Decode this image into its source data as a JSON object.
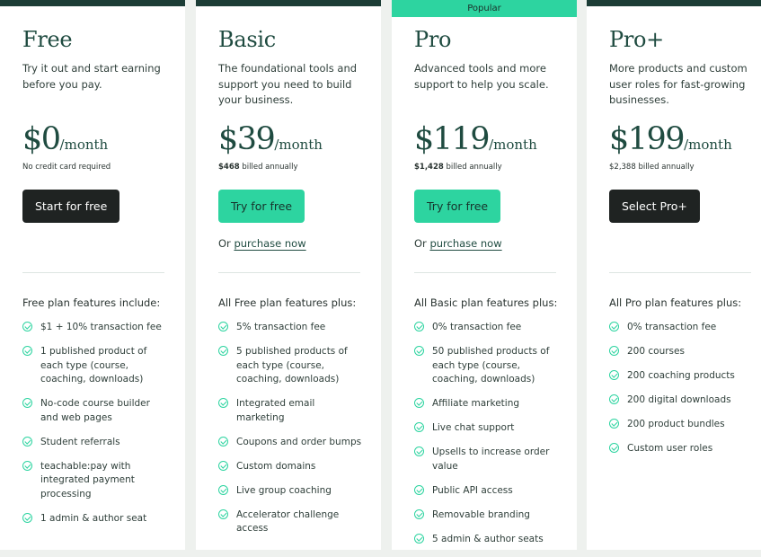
{
  "colors": {
    "dark_green": "#1c3d36",
    "accent_green": "#2dd4a0",
    "dark_button": "#1f2322",
    "background": "#eef1ee"
  },
  "plans": [
    {
      "name": "Free",
      "description": "Try it out and start earning before you pay.",
      "price_amount": "$0",
      "price_period": "/month",
      "billing_bold": "",
      "billing_text": "No credit card required",
      "cta_label": "Start for free",
      "or_prefix": "",
      "or_link": "",
      "features_heading": "Free plan features include:",
      "features": [
        "$1 + 10% transaction fee",
        "1 published product of each type (course, coaching, downloads)",
        "No-code course builder and web pages",
        "Student referrals",
        "teachable:pay with integrated payment processing",
        "1 admin & author seat"
      ]
    },
    {
      "name": "Basic",
      "description": "The foundational tools and support you need to build your business.",
      "price_amount": "$39",
      "price_period": "/month",
      "billing_bold": "$468",
      "billing_text": " billed annually",
      "cta_label": "Try for free",
      "or_prefix": "Or ",
      "or_link": "purchase now",
      "features_heading": "All Free plan features plus:",
      "features": [
        "5% transaction fee",
        "5 published products of each type (course, coaching, downloads)",
        "Integrated email marketing",
        "Coupons and order bumps",
        "Custom domains",
        "Live group coaching",
        "Accelerator challenge access"
      ]
    },
    {
      "badge": "Popular",
      "name": "Pro",
      "description": "Advanced tools and more support to help you scale.",
      "price_amount": "$119",
      "price_period": "/month",
      "billing_bold": "$1,428",
      "billing_text": " billed annually",
      "cta_label": "Try for free",
      "or_prefix": "Or ",
      "or_link": "purchase now",
      "features_heading": "All Basic plan features plus:",
      "features": [
        "0% transaction fee",
        "50 published products of each type (course, coaching, downloads)",
        "Affiliate marketing",
        "Live chat support",
        "Upsells to increase order value",
        "Public API access",
        "Removable branding",
        "5 admin & author seats"
      ]
    },
    {
      "name": "Pro+",
      "description": "More products and custom user roles for fast-growing businesses.",
      "price_amount": "$199",
      "price_period": "/month",
      "billing_bold": "",
      "billing_text": "$2,388 billed annually",
      "cta_label": "Select Pro+",
      "or_prefix": "",
      "or_link": "",
      "features_heading": "All Pro plan features plus:",
      "features": [
        "0% transaction fee",
        "200 courses",
        "200 coaching products",
        "200 digital downloads",
        "200 product bundles",
        "Custom user roles"
      ]
    }
  ]
}
